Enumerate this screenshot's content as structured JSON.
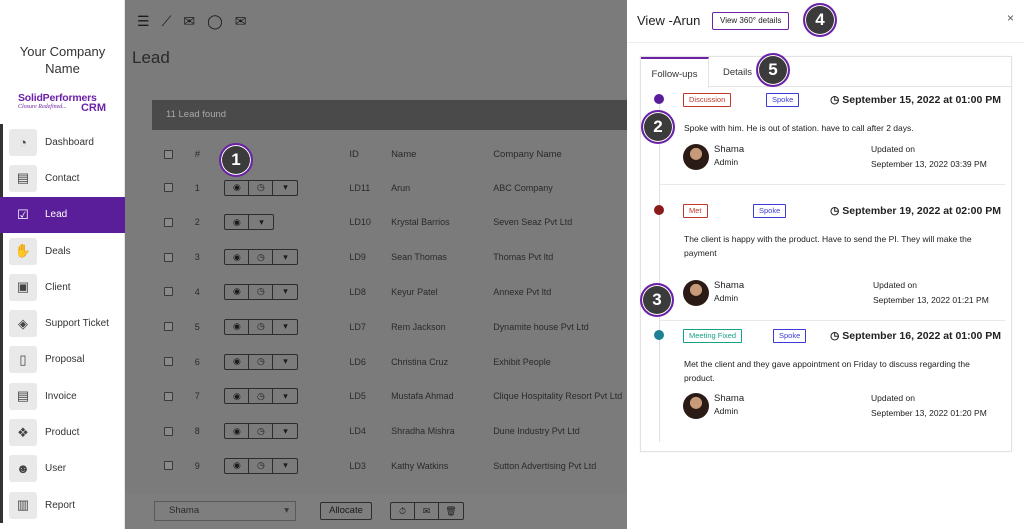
{
  "sidebar": {
    "company": [
      "Your Company",
      "Name"
    ],
    "logo": {
      "line1": "SolidPerformers",
      "line2": "Closure Redefined...",
      "crm": "CRM"
    },
    "items": [
      {
        "label": "Dashboard",
        "icon": "dashboard-icon",
        "glyph": "◔"
      },
      {
        "label": "Contact",
        "icon": "contact-card-icon",
        "glyph": "▤"
      },
      {
        "label": "Lead",
        "icon": "checkbox-icon",
        "glyph": "☑",
        "active": true
      },
      {
        "label": "Deals",
        "icon": "handshake-icon",
        "glyph": "✋"
      },
      {
        "label": "Client",
        "icon": "briefcase-icon",
        "glyph": "▣"
      },
      {
        "label": "Support Ticket",
        "icon": "ticket-icon",
        "glyph": "◈"
      },
      {
        "label": "Proposal",
        "icon": "document-icon",
        "glyph": "▯"
      },
      {
        "label": "Invoice",
        "icon": "invoice-icon",
        "glyph": "▤"
      },
      {
        "label": "Product",
        "icon": "cubes-icon",
        "glyph": "❖"
      },
      {
        "label": "User",
        "icon": "users-icon",
        "glyph": "☻"
      },
      {
        "label": "Report",
        "icon": "bar-chart-icon",
        "glyph": "▥"
      }
    ]
  },
  "main": {
    "page_title": "Lead",
    "lead_count": "11 Lead found",
    "columns": {
      "num": "#",
      "id": "ID",
      "name": "Name",
      "company": "Company Name"
    },
    "rows": [
      {
        "num": "1",
        "id": "LD11",
        "name": "Arun",
        "company": "ABC Company",
        "actions": 3
      },
      {
        "num": "2",
        "id": "LD10",
        "name": "Krystal Barrios",
        "company": "Seven Seaz Pvt Ltd",
        "actions": 2
      },
      {
        "num": "3",
        "id": "LD9",
        "name": "Sean Thomas",
        "company": "Thomas Pvt ltd",
        "actions": 3
      },
      {
        "num": "4",
        "id": "LD8",
        "name": "Keyur Patel",
        "company": "Annexe Pvt ltd",
        "actions": 3
      },
      {
        "num": "5",
        "id": "LD7",
        "name": "Rem Jackson",
        "company": "Dynamite house Pvt Ltd",
        "actions": 3
      },
      {
        "num": "6",
        "id": "LD6",
        "name": "Christina Cruz",
        "company": "Exhibit People",
        "actions": 3
      },
      {
        "num": "7",
        "id": "LD5",
        "name": "Mustafa Ahmad",
        "company": "Clique Hospitality Resort Pvt Ltd",
        "actions": 3
      },
      {
        "num": "8",
        "id": "LD4",
        "name": "Shradha Mishra",
        "company": "Dune Industry Pvt Ltd",
        "actions": 3
      },
      {
        "num": "9",
        "id": "LD3",
        "name": "Kathy Watkins",
        "company": "Sutton Advertising Pvt Ltd",
        "actions": 3
      }
    ],
    "bottom": {
      "assignee": "Shama",
      "allocate": "Allocate"
    }
  },
  "panel": {
    "title": "View -Arun",
    "view360": "View 360° details",
    "close": "×",
    "tabs": [
      "Follow-ups",
      "Details"
    ],
    "followups": [
      {
        "type": "Discussion",
        "type_color": "#c0392b",
        "mode": "Spoke",
        "mode_color": "#3b3bd6",
        "dot_color": "#5b1e9b",
        "datetime": "September 15, 2022 at 01:00 PM",
        "note": "Spoke with him. He is out of station. have to call after 2 days.",
        "user": "Shama",
        "role": "Admin",
        "updated_label": "Updated on",
        "updated": "September 13, 2022 03:39 PM"
      },
      {
        "type": "Met",
        "type_color": "#c0392b",
        "mode": "Spoke",
        "mode_color": "#3b3bd6",
        "dot_color": "#8b1a1a",
        "datetime": "September 19, 2022 at 02:00 PM",
        "note": "The client is happy with the product. Have to send the PI. They will make the payment",
        "user": "Shama",
        "role": "Admin",
        "updated_label": "Updated on",
        "updated": "September 13, 2022 01:21 PM"
      },
      {
        "type": "Meeting Fixed",
        "type_color": "#16a085",
        "mode": "Spoke",
        "mode_color": "#3b3bd6",
        "dot_color": "#1f7f94",
        "datetime": "September 16, 2022 at 01:00 PM",
        "note": "Met the client and they gave appointment on Friday to discuss regarding the product.",
        "user": "Shama",
        "role": "Admin",
        "updated_label": "Updated on",
        "updated": "September 13, 2022 01:20 PM"
      }
    ]
  },
  "markers": [
    "1",
    "2",
    "3",
    "4",
    "5"
  ],
  "colors": {
    "accent": "#5b1e9b",
    "overlay": "#7b7b7b"
  }
}
